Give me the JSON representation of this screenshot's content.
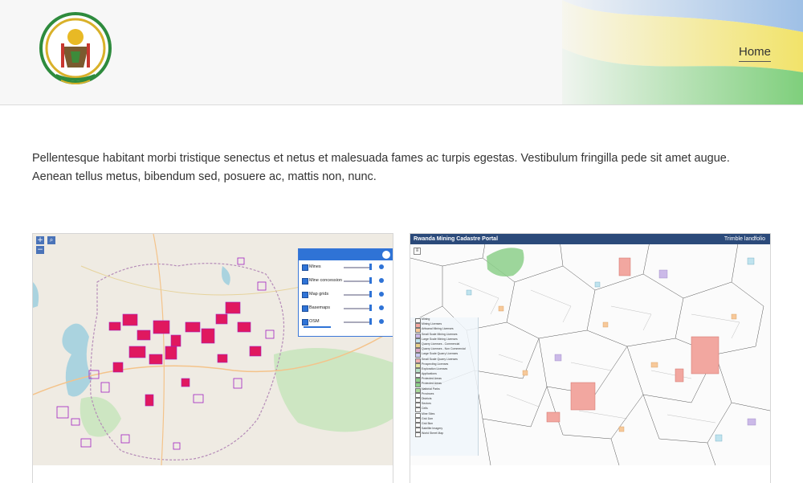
{
  "header": {
    "nav_home": "Home",
    "flag_colors": {
      "blue": "#9fc0e6",
      "yellow": "#f2e36a",
      "green": "#7fcf7c"
    }
  },
  "intro": {
    "text": "Pellentesque habitant morbi tristique senectus et netus et malesuada fames ac turpis egestas. Vestibulum fringilla pede sit amet augue. Aenean tellus metus, bibendum sed, posuere ac, mattis non, nunc."
  },
  "cards": [
    {
      "zoom_in": "+",
      "zoom_out": "−",
      "layers": [
        "Mines",
        "Mine concession",
        "Map grids",
        "Basemaps",
        "OSM"
      ]
    },
    {
      "portal_title": "Rwanda Mining Cadastre Portal",
      "portal_brand": "Trimble landfolio",
      "legend": [
        "Mining",
        "Mining Licenses",
        "Artisanal Mining Licenses",
        "Small Scale Mining Licenses",
        "Large Scale Mining Licenses",
        "Quarry Licenses - Commercial",
        "Quarry Licenses - Non Commercial",
        "Large Scale Quarry Licenses",
        "Small Scale Quarry Licenses",
        "Prospecting Licenses",
        "Exploration Licenses",
        "Applications",
        "Protected Areas",
        "Protected Areas",
        "National Parks",
        "Provinces",
        "Districts",
        "Sectors",
        "Cells",
        "Mine Sites",
        "Grid 1km",
        "Grid 5km",
        "Satellite Imagery",
        "World Street Map"
      ]
    }
  ]
}
